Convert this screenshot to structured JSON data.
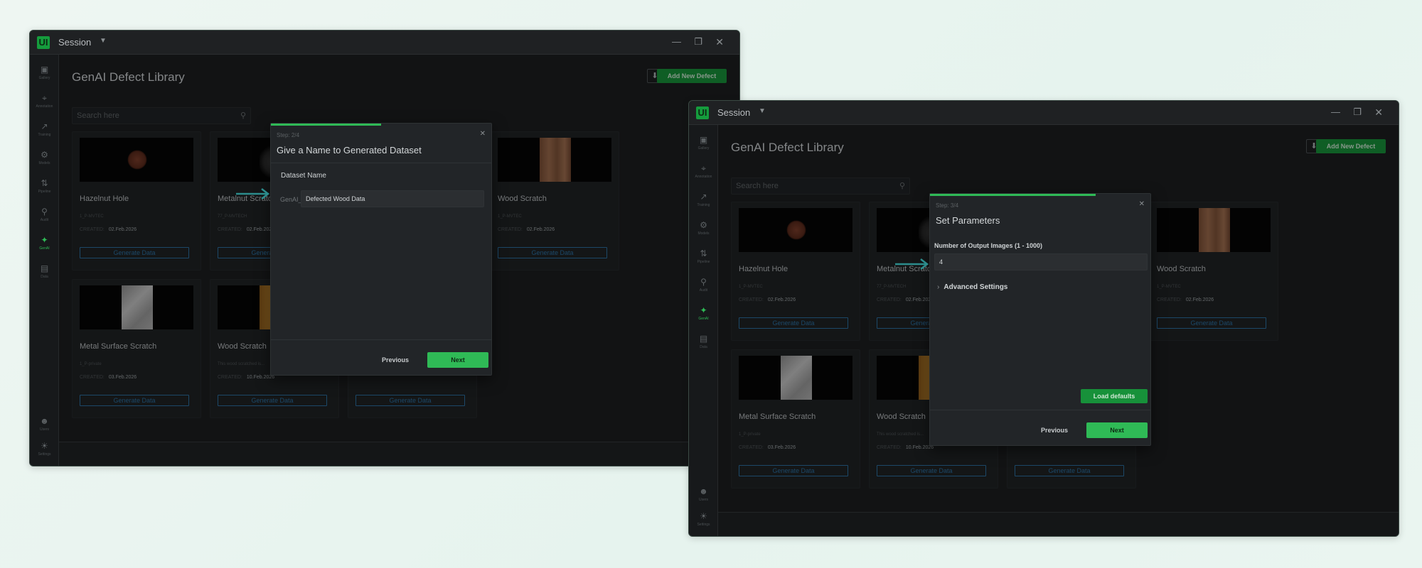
{
  "session": {
    "label": "Session",
    "logo": "UI"
  },
  "page": {
    "title": "GenAI Defect Library",
    "add_button": "Add New Defect"
  },
  "search": {
    "placeholder": "Search here"
  },
  "sidebar": {
    "items": [
      {
        "label": "Gallery",
        "icon": "image-icon"
      },
      {
        "label": "Annotation",
        "icon": "crop-icon"
      },
      {
        "label": "Training",
        "icon": "chart-line-icon"
      },
      {
        "label": "Models",
        "icon": "gear-icon"
      },
      {
        "label": "Pipeline",
        "icon": "pipeline-icon"
      },
      {
        "label": "Audit",
        "icon": "search-zoom-icon"
      },
      {
        "label": "GenAI",
        "icon": "magic-wand-icon"
      },
      {
        "label": "Data",
        "icon": "clipboard-icon"
      }
    ],
    "bottom": [
      {
        "label": "Users",
        "icon": "user-icon"
      },
      {
        "label": "Settings",
        "icon": "sun-icon"
      }
    ]
  },
  "cards": [
    {
      "name": "Hazelnut Hole",
      "author": "1_P-MVTEC",
      "created_label": "CREATED:",
      "date": "02.Feb.2026",
      "button": "Generate Data"
    },
    {
      "name": "Metalnut Scratch",
      "author": "77_P-MVTECH",
      "created_label": "CREATED:",
      "date": "02.Feb.2026",
      "button": "Generate Data"
    },
    {
      "name": "Wood Scratch",
      "author": "1_P-MVTEC",
      "created_label": "CREATED:",
      "date": "02.Feb.2026",
      "button": "Generate Data"
    },
    {
      "name": "Metal Surface Scratch",
      "author": "1_P-private",
      "created_label": "CREATED:",
      "date": "03.Feb.2026",
      "button": "Generate Data"
    },
    {
      "name": "Wood Scratch",
      "author": "This wood scratched is...",
      "created_label": "CREATED:",
      "date": "10.Feb.2026",
      "button": "Generate Data"
    },
    {
      "name": "",
      "author": "",
      "created_label": "",
      "date": "",
      "button": "Generate Data"
    }
  ],
  "dialog1": {
    "step": "Step: 2/4",
    "title": "Give a Name to Generated Dataset",
    "field_label": "Dataset Name",
    "prefix": "GenAI_",
    "value": "Defected Wood Data",
    "previous": "Previous",
    "next": "Next",
    "progress": 0.5
  },
  "dialog2": {
    "step": "Step: 3/4",
    "title": "Set Parameters",
    "field_label": "Number of Output Images (1 - 1000)",
    "value": "4",
    "advanced": "Advanced Settings",
    "load_defaults": "Load defaults",
    "previous": "Previous",
    "next": "Next",
    "progress": 0.75
  },
  "colors": {
    "accent": "#2fba56",
    "accent_dark": "#17913a",
    "link_blue": "#2b6fa0",
    "arrow": "#2c8c8c"
  }
}
